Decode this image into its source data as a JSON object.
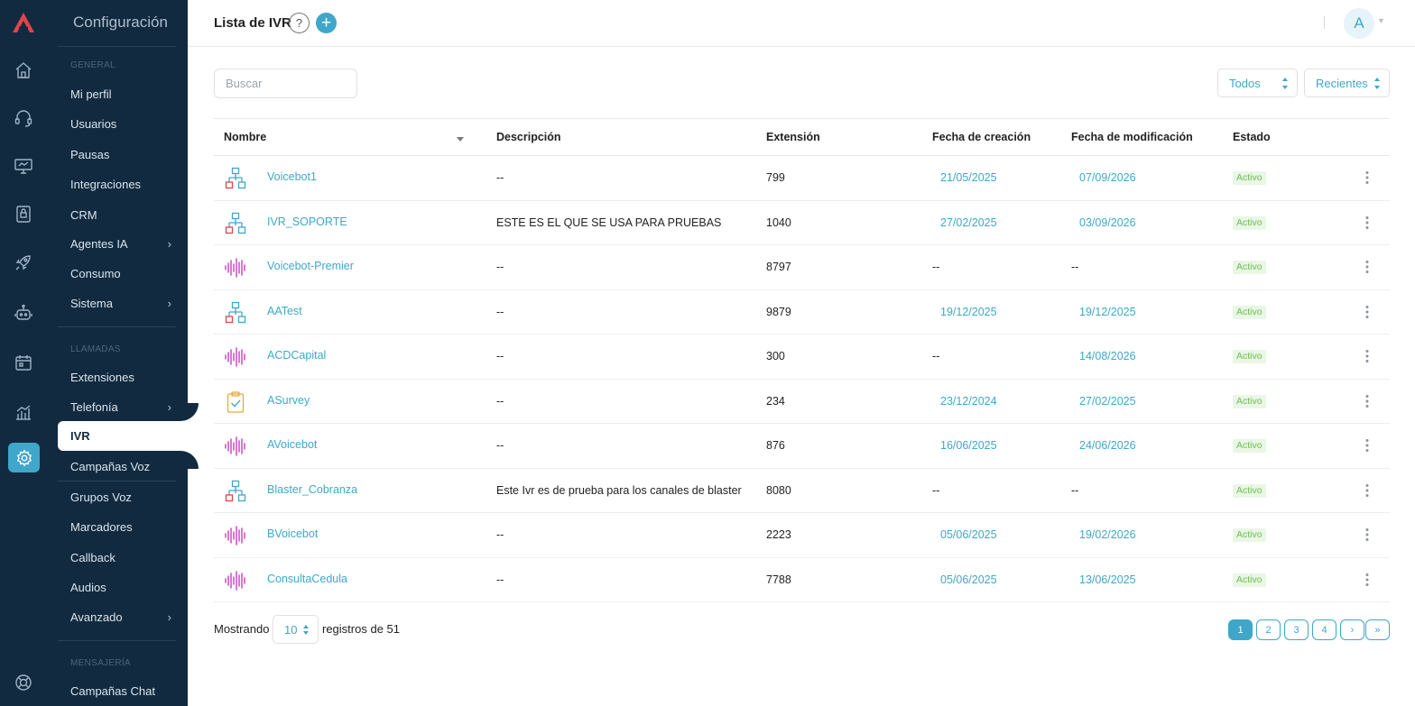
{
  "sidebar": {
    "title": "Configuración",
    "sections": {
      "general": "GENERAL",
      "llamadas": "LLAMADAS",
      "mensajeria": "MENSAJERÍA"
    },
    "items": {
      "mi_perfil": "Mi perfil",
      "usuarios": "Usuarios",
      "pausas": "Pausas",
      "integraciones": "Integraciones",
      "crm": "CRM",
      "agentes_ia": "Agentes IA",
      "consumo": "Consumo",
      "sistema": "Sistema",
      "extensiones": "Extensiones",
      "telefonia": "Telefonía",
      "ivr": "IVR",
      "campanas_voz": "Campañas Voz",
      "grupos_voz": "Grupos Voz",
      "marcadores": "Marcadores",
      "callback": "Callback",
      "audios": "Audios",
      "avanzado": "Avanzado",
      "campanas_chat": "Campañas Chat"
    },
    "chevron": "›"
  },
  "header": {
    "title": "Lista de IVR",
    "help_label": "?",
    "add_label": "+",
    "avatar_initial": "A"
  },
  "toolbar": {
    "search_placeholder": "Buscar",
    "filter_value": "Todos",
    "sort_value": "Recientes"
  },
  "table": {
    "columns": {
      "nombre": "Nombre",
      "descripcion": "Descripción",
      "extension": "Extensión",
      "creacion": "Fecha de creación",
      "modificacion": "Fecha de modificación",
      "estado": "Estado"
    },
    "rows": [
      {
        "type": "flow",
        "name": "Voicebot1",
        "description": "--",
        "extension": "799",
        "created": "21/05/2025",
        "modified": "07/09/2026",
        "status": "Activo"
      },
      {
        "type": "flow",
        "name": "IVR_SOPORTE",
        "description": "ESTE ES EL QUE SE USA PARA PRUEBAS",
        "extension": "1040",
        "created": "27/02/2025",
        "modified": "03/09/2026",
        "status": "Activo"
      },
      {
        "type": "voicebot",
        "name": "Voicebot-Premier",
        "description": "--",
        "extension": "8797",
        "created": "--",
        "modified": "--",
        "status": "Activo"
      },
      {
        "type": "flow",
        "name": "AATest",
        "description": "--",
        "extension": "9879",
        "created": "19/12/2025",
        "modified": "19/12/2025",
        "status": "Activo"
      },
      {
        "type": "voicebot",
        "name": "ACDCapital",
        "description": "--",
        "extension": "300",
        "created": "--",
        "modified": "14/08/2026",
        "status": "Activo"
      },
      {
        "type": "survey",
        "name": "ASurvey",
        "description": "--",
        "extension": "234",
        "created": "23/12/2024",
        "modified": "27/02/2025",
        "status": "Activo"
      },
      {
        "type": "voicebot",
        "name": "AVoicebot",
        "description": "--",
        "extension": "876",
        "created": "16/06/2025",
        "modified": "24/06/2026",
        "status": "Activo"
      },
      {
        "type": "flow",
        "name": "Blaster_Cobranza",
        "description": "Este Ivr es de prueba para los canales de blaster",
        "extension": "8080",
        "created": "--",
        "modified": "--",
        "status": "Activo"
      },
      {
        "type": "voicebot",
        "name": "BVoicebot",
        "description": "--",
        "extension": "2223",
        "created": "05/06/2025",
        "modified": "19/02/2026",
        "status": "Activo"
      },
      {
        "type": "voicebot",
        "name": "ConsultaCedula",
        "description": "--",
        "extension": "7788",
        "created": "05/06/2025",
        "modified": "13/06/2025",
        "status": "Activo"
      }
    ]
  },
  "footer": {
    "showing_label": "Mostrando",
    "page_length": "10",
    "records_label": "registros de 51",
    "pages": [
      "1",
      "2",
      "3",
      "4",
      "›",
      "»"
    ],
    "current_page": "1"
  },
  "colors": {
    "sidebar_bg": "#112a40",
    "accent": "#3fa7c9",
    "logo": "#e2444a",
    "status_green": "#6bbf4d",
    "voicebot_icon": "#c73fbf"
  },
  "icons": {
    "rail": [
      "home-icon",
      "headset-icon",
      "monitor-icon",
      "lock-icon",
      "rocket-icon",
      "robot-icon",
      "calendar-icon",
      "chart-icon",
      "settings-icon",
      "help-circle-icon"
    ],
    "row_types": {
      "flow": "flow-diagram-icon",
      "voicebot": "sound-wave-icon",
      "survey": "clipboard-check-icon"
    }
  }
}
